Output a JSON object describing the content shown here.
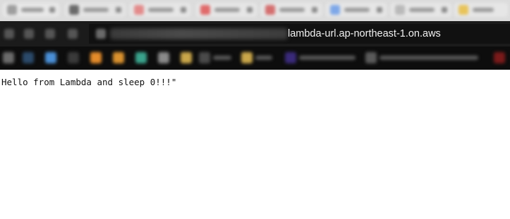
{
  "browser": {
    "address_bar": {
      "url_visible": "lambda-url.ap-northeast-1.on.aws"
    }
  },
  "page": {
    "body_text": "Hello from Lambda and sleep 0!!!\""
  },
  "colors": {
    "toolbar_bg": "#1b1b1b",
    "bookmarks_bg": "#0d0d0d",
    "tabstrip_bg": "#dcdcdc",
    "page_bg": "#ffffff",
    "text": "#111111"
  }
}
